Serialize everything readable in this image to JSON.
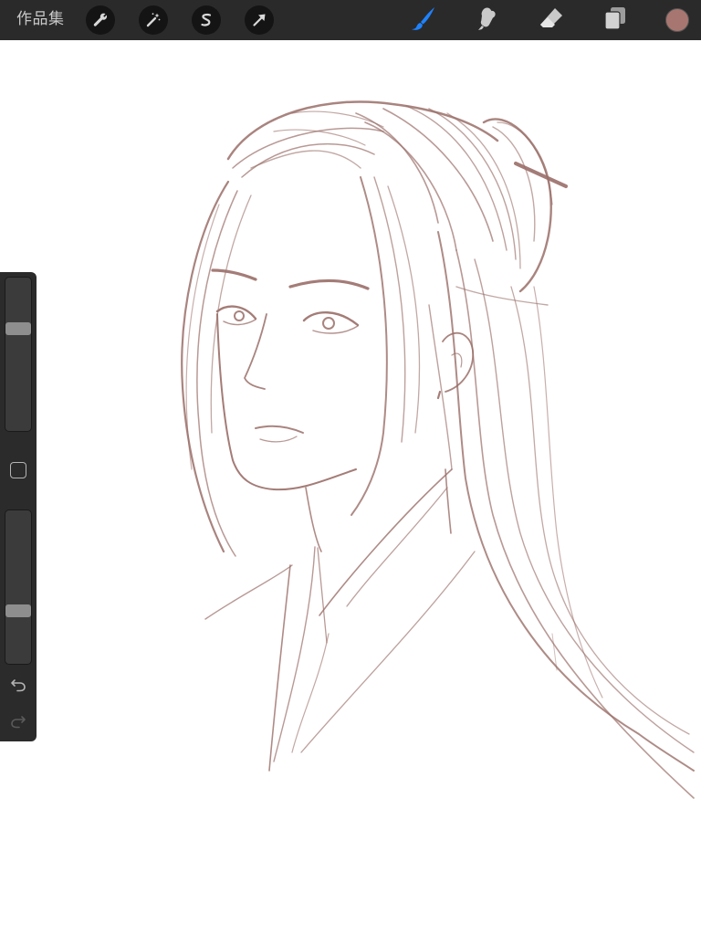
{
  "toolbar": {
    "gallery_label": "作品集",
    "left_tools": [
      {
        "name": "wrench-icon"
      },
      {
        "name": "magic-wand-icon"
      },
      {
        "name": "selection-icon"
      },
      {
        "name": "transform-arrow-icon"
      }
    ],
    "right_tools": [
      {
        "name": "brush-icon",
        "active": true
      },
      {
        "name": "smudge-icon",
        "active": false
      },
      {
        "name": "eraser-icon",
        "active": false
      },
      {
        "name": "layers-icon",
        "active": false
      }
    ],
    "current_color": "#a87670",
    "active_tool_color": "#1e82ff"
  },
  "sidebar": {
    "brush_size_level": 0.68,
    "opacity_level": 0.33,
    "icons": [
      "modify-square-icon",
      "undo-icon",
      "redo-icon"
    ]
  },
  "canvas": {
    "stroke_color": "#9a6e68",
    "background": "#ffffff"
  }
}
